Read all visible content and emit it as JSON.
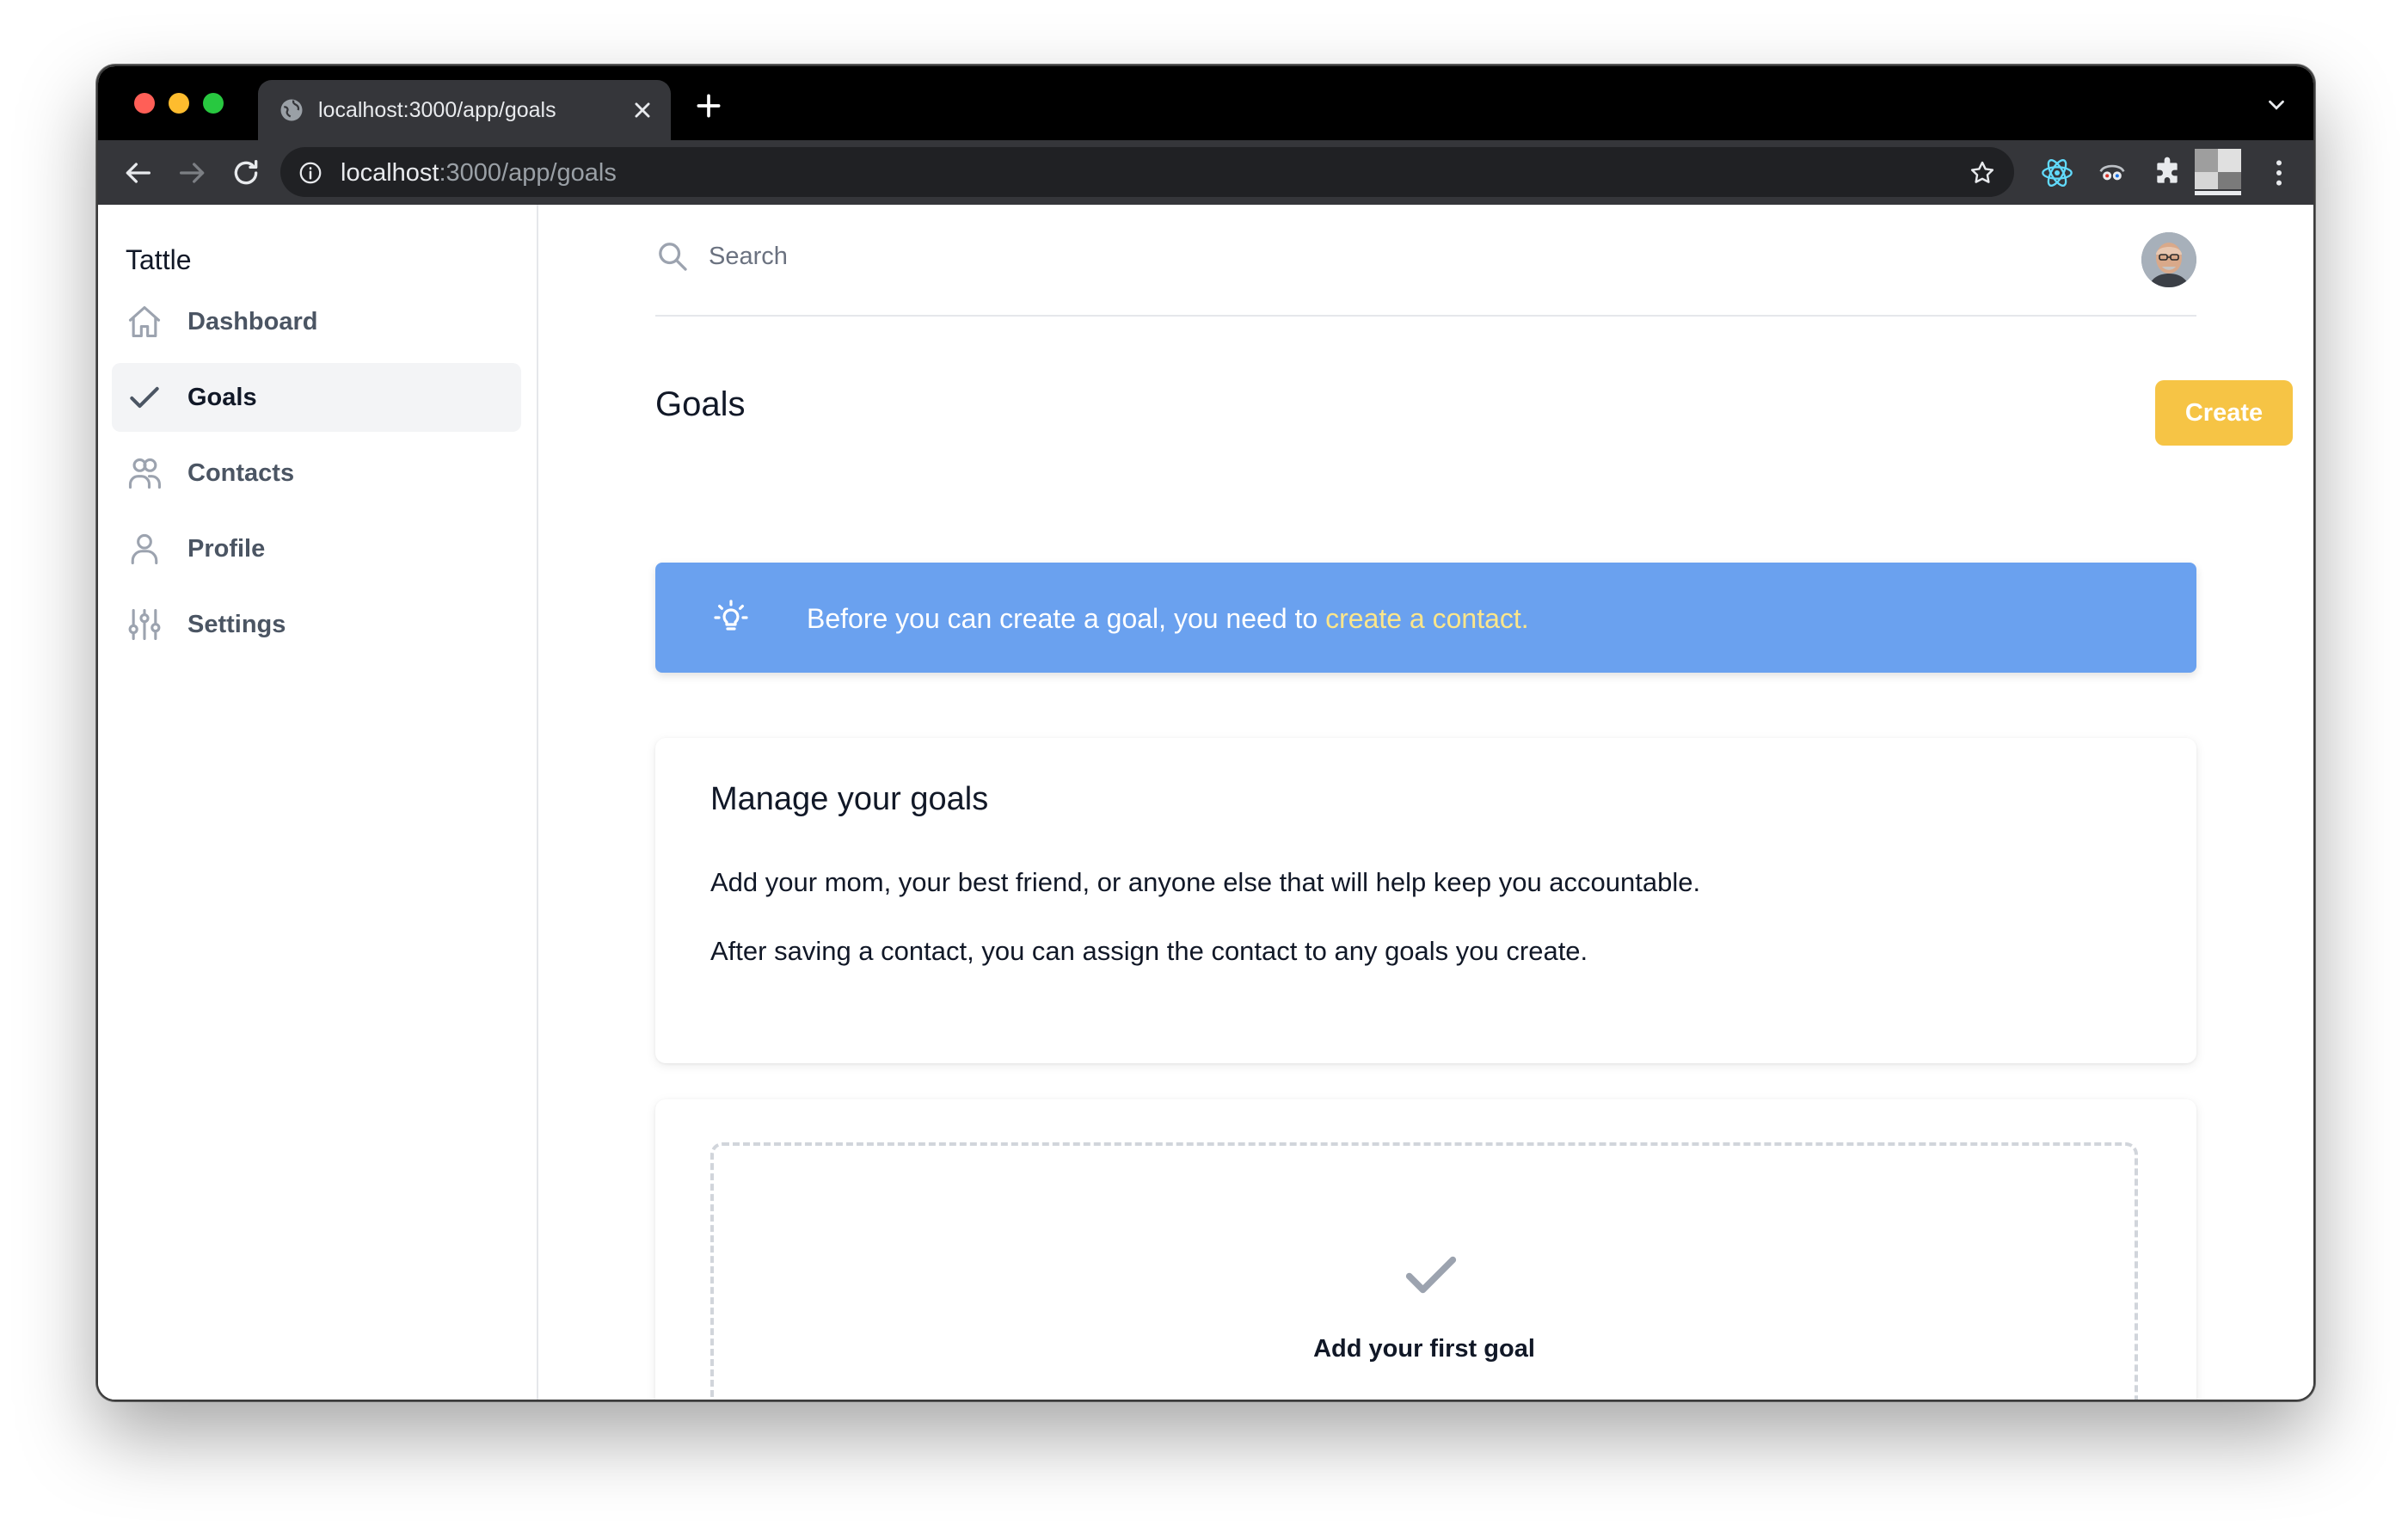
{
  "browser": {
    "tab_title": "localhost:3000/app/goals",
    "url_host": "localhost",
    "url_path": ":3000/app/goals"
  },
  "sidebar": {
    "brand": "Tattle",
    "items": [
      {
        "label": "Dashboard",
        "icon": "home-icon",
        "active": false
      },
      {
        "label": "Goals",
        "icon": "check-icon",
        "active": true
      },
      {
        "label": "Contacts",
        "icon": "users-icon",
        "active": false
      },
      {
        "label": "Profile",
        "icon": "user-icon",
        "active": false
      },
      {
        "label": "Settings",
        "icon": "sliders-icon",
        "active": false
      }
    ]
  },
  "header": {
    "search_placeholder": "Search"
  },
  "page": {
    "title": "Goals",
    "create_label": "Create"
  },
  "banner": {
    "text": "Before you can create a goal, you need to ",
    "link": "create a contact."
  },
  "manage": {
    "title": "Manage your goals",
    "p1": "Add your mom, your best friend, or anyone else that will help keep you accountable.",
    "p2": "After saving a contact, you can assign the contact to any goals you create."
  },
  "empty": {
    "label": "Add your first goal"
  },
  "colors": {
    "accent": "#f6c445",
    "banner": "#6aa1ef",
    "link": "#fde68a"
  }
}
